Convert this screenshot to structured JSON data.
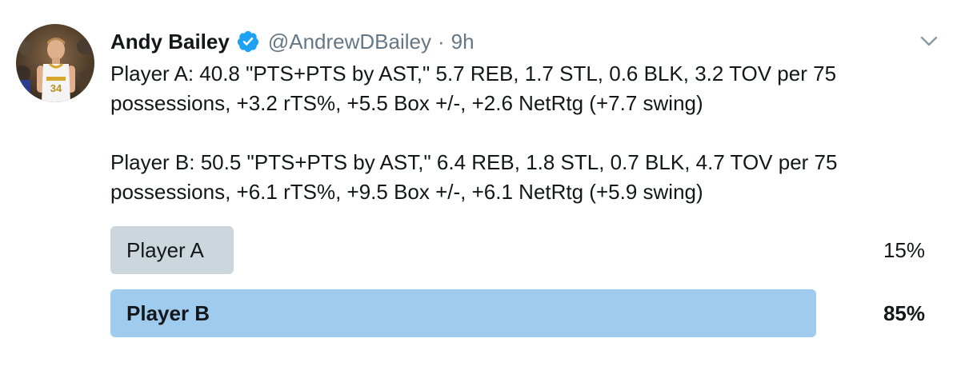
{
  "author": {
    "name": "Andy Bailey",
    "handle": "@AndrewDBailey",
    "separator": "·",
    "time": "9h",
    "verified": true
  },
  "tweet": {
    "paragraphs": [
      "Player A: 40.8 \"PTS+PTS by AST,\" 5.7 REB, 1.7 STL, 0.6 BLK, 3.2 TOV per 75 possessions, +3.2 rTS%, +5.5 Box +/-, +2.6 NetRtg (+7.7 swing)",
      "Player B: 50.5 \"PTS+PTS by AST,\" 6.4 REB, 1.8 STL, 0.7 BLK, 4.7 TOV per 75 possessions, +6.1 rTS%, +9.5 Box +/-, +6.1 NetRtg (+5.9 swing)"
    ]
  },
  "poll": {
    "options": [
      {
        "label": "Player A",
        "percent": "15%",
        "share": 0.15,
        "winner": false
      },
      {
        "label": "Player B",
        "percent": "85%",
        "share": 0.85,
        "winner": true
      }
    ]
  },
  "colors": {
    "text": "#14171a",
    "muted": "#657786",
    "verified_blue": "#1da1f2",
    "poll_loser": "#ccd6dd",
    "poll_winner": "#9fcbee"
  },
  "icons": {
    "verified": "verified-badge-icon",
    "menu": "chevron-down-icon",
    "avatar": "profile-photo"
  }
}
